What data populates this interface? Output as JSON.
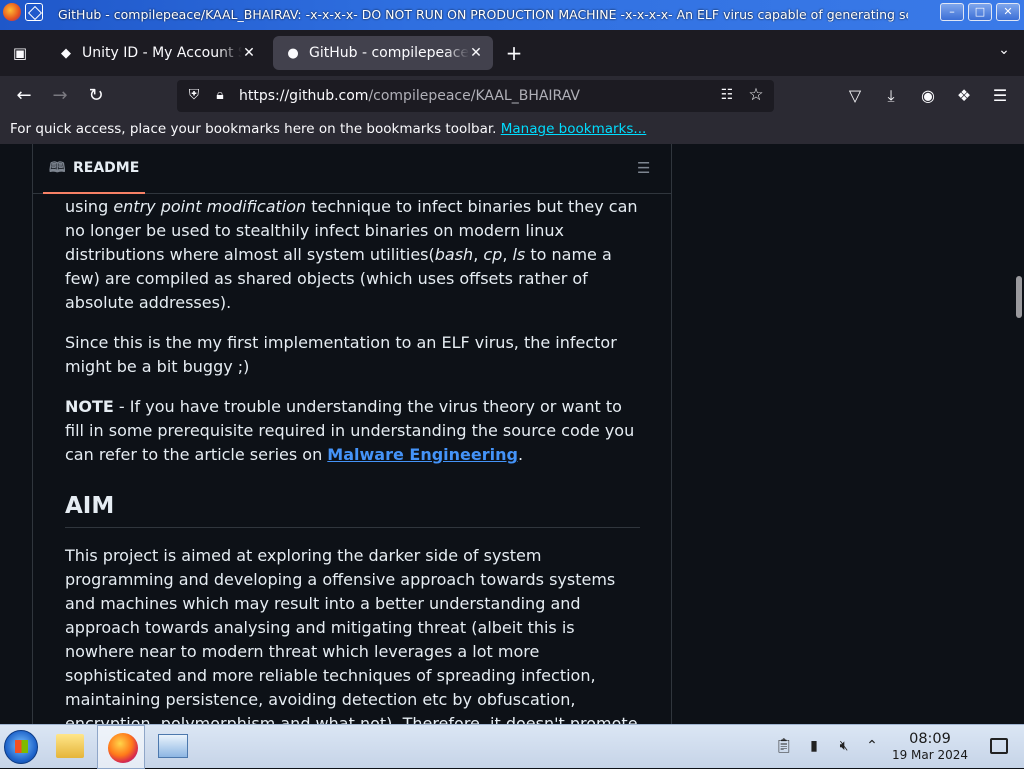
{
  "window": {
    "title": "GitHub - compilepeace/KAAL_BHAIRAV: -x-x-x-x- DO NOT RUN ON PRODUCTION MACHINE -x-x-x-x- An ELF virus capable of generating seg...",
    "min_label": "–",
    "max_label": "□",
    "close_label": "✕"
  },
  "tabs": [
    {
      "title": "Unity ID - My Account Se",
      "favicon": "◆",
      "active": false
    },
    {
      "title": "GitHub - compilepeace/K",
      "favicon": "●",
      "active": true
    }
  ],
  "tab_close_label": "✕",
  "new_tab_label": "+",
  "address": {
    "url_host": "https://github.com",
    "url_path": "/compilepeace/KAAL_BHAIRAV"
  },
  "bookmarks_bar": {
    "text": "For quick access, place your bookmarks here on the bookmarks toolbar.",
    "link": "Manage bookmarks..."
  },
  "readme": {
    "tab_label": "README",
    "paragraphs": {
      "p1": {
        "a": "using ",
        "b": "entry point modification",
        "c": " technique to infect binaries but they can no longer be used to stealthily infect binaries on modern linux distributions where almost all system utilities(",
        "d": "bash",
        "e": ", ",
        "f": "cp",
        "g": ", ",
        "h": "ls",
        "i": " to name a few) are compiled as shared objects (which uses offsets rather of absolute addresses)."
      },
      "p2": "Since this is the my first implementation to an ELF virus, the infector might be a bit buggy ;)",
      "p3": {
        "label": "NOTE",
        "text": " - If you have trouble understanding the virus theory or want to fill in some prerequisite required in understanding the source code you can refer to the article series on ",
        "link": "Malware Engineering",
        "end": "."
      },
      "heading": "AIM",
      "p4": "This project is aimed at exploring the darker side of system programming and developing a offensive approach towards systems and machines which may result into a better understanding and approach towards analysing and mitigating threat (albeit this is nowhere near to modern threat which leverages a lot more sophisticated and more reliable techniques of spreading infection, maintaining persistence, avoiding detection etc by obfuscation, encryption, polymorphism and what not). Therefore, it doesn't promote destruction (in any context) rather only learning is promoted."
    }
  },
  "taskbar": {
    "time": "08:09",
    "date": "19 Mar 2024"
  },
  "colors": {
    "page_bg": "#0d1117",
    "text": "#e6edf3",
    "link": "#4493f8",
    "accent_underline": "#f78166",
    "firefox_toolbar": "#2b2a33",
    "firefox_tabbar": "#1c1b22"
  }
}
